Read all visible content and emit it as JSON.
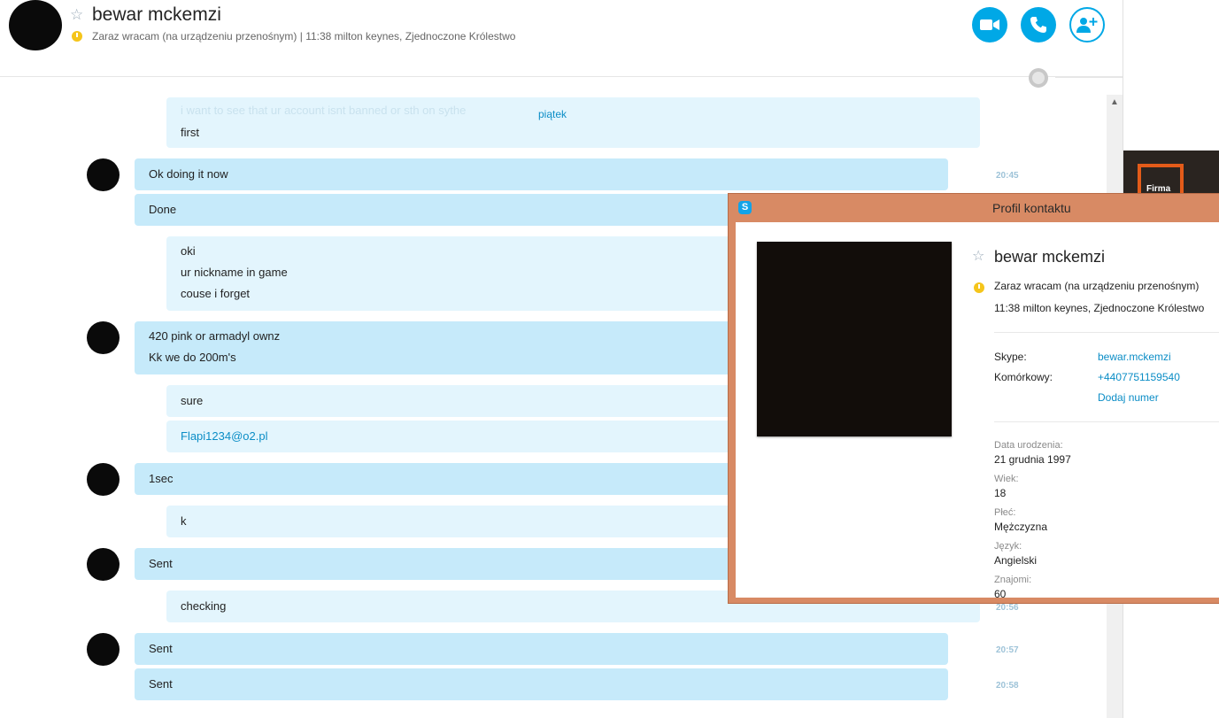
{
  "header": {
    "contact_name": "bewar mckemzi",
    "status_line": "Zaraz wracam (na urządzeniu przenośnym)  |  11:38 milton keynes, Zjednoczone Królestwo",
    "buttons": [
      "video-call",
      "voice-call",
      "add-contact"
    ]
  },
  "chat": {
    "faded_text": "i want to see that ur account isnt banned or sth on sythe",
    "day_header": "piątek",
    "messages": [
      {
        "from": "me",
        "lines": [
          "first"
        ],
        "time": ""
      },
      {
        "from": "them",
        "lines": [
          "Ok doing it now"
        ],
        "time": "20:45"
      },
      {
        "from": "them",
        "lines": [
          "Done"
        ],
        "time": ""
      },
      {
        "from": "me",
        "lines": [
          "oki",
          "ur nickname in game",
          "couse i forget"
        ],
        "time": ""
      },
      {
        "from": "them",
        "lines": [
          "420 pink or armadyl ownz",
          "Kk we do 200m's"
        ],
        "time": ""
      },
      {
        "from": "me",
        "lines": [
          "sure"
        ],
        "time": ""
      },
      {
        "from": "me",
        "lines": [
          "Flapi1234@o2.pl"
        ],
        "time": ""
      },
      {
        "from": "them",
        "lines": [
          "1sec"
        ],
        "time": ""
      },
      {
        "from": "me",
        "lines": [
          "k"
        ],
        "time": ""
      },
      {
        "from": "them",
        "lines": [
          "Sent"
        ],
        "time": ""
      },
      {
        "from": "me",
        "lines": [
          "checking"
        ],
        "time": "20:56"
      },
      {
        "from": "them",
        "lines": [
          "Sent"
        ],
        "time": "20:57"
      },
      {
        "from": "them",
        "lines": [
          "Sent"
        ],
        "time": "20:58"
      }
    ]
  },
  "thumbnail": {
    "label": "Firma"
  },
  "profile": {
    "title": "Profil kontaktu",
    "name": "bewar mckemzi",
    "status": "Zaraz wracam (na urządzeniu przenośnym)",
    "location": "11:38 milton keynes, Zjednoczone Królestwo",
    "skype_label": "Skype:",
    "skype_value": "bewar.mckemzi",
    "mobile_label": "Komórkowy:",
    "mobile_value": "+4407751159540",
    "add_number": "Dodaj numer",
    "details": [
      {
        "label": "Data urodzenia:",
        "value": "21 grudnia 1997"
      },
      {
        "label": "Wiek:",
        "value": "18"
      },
      {
        "label": "Płeć:",
        "value": "Mężczyzna"
      },
      {
        "label": "Język:",
        "value": "Angielski"
      },
      {
        "label": "Znajomi:",
        "value": "60"
      }
    ]
  },
  "colors": {
    "accent": "#00a8e6",
    "bubble_them": "#c6eafa",
    "bubble_me": "#e3f5fd",
    "profile_frame": "#d88a64",
    "status_away": "#f5c51b"
  }
}
